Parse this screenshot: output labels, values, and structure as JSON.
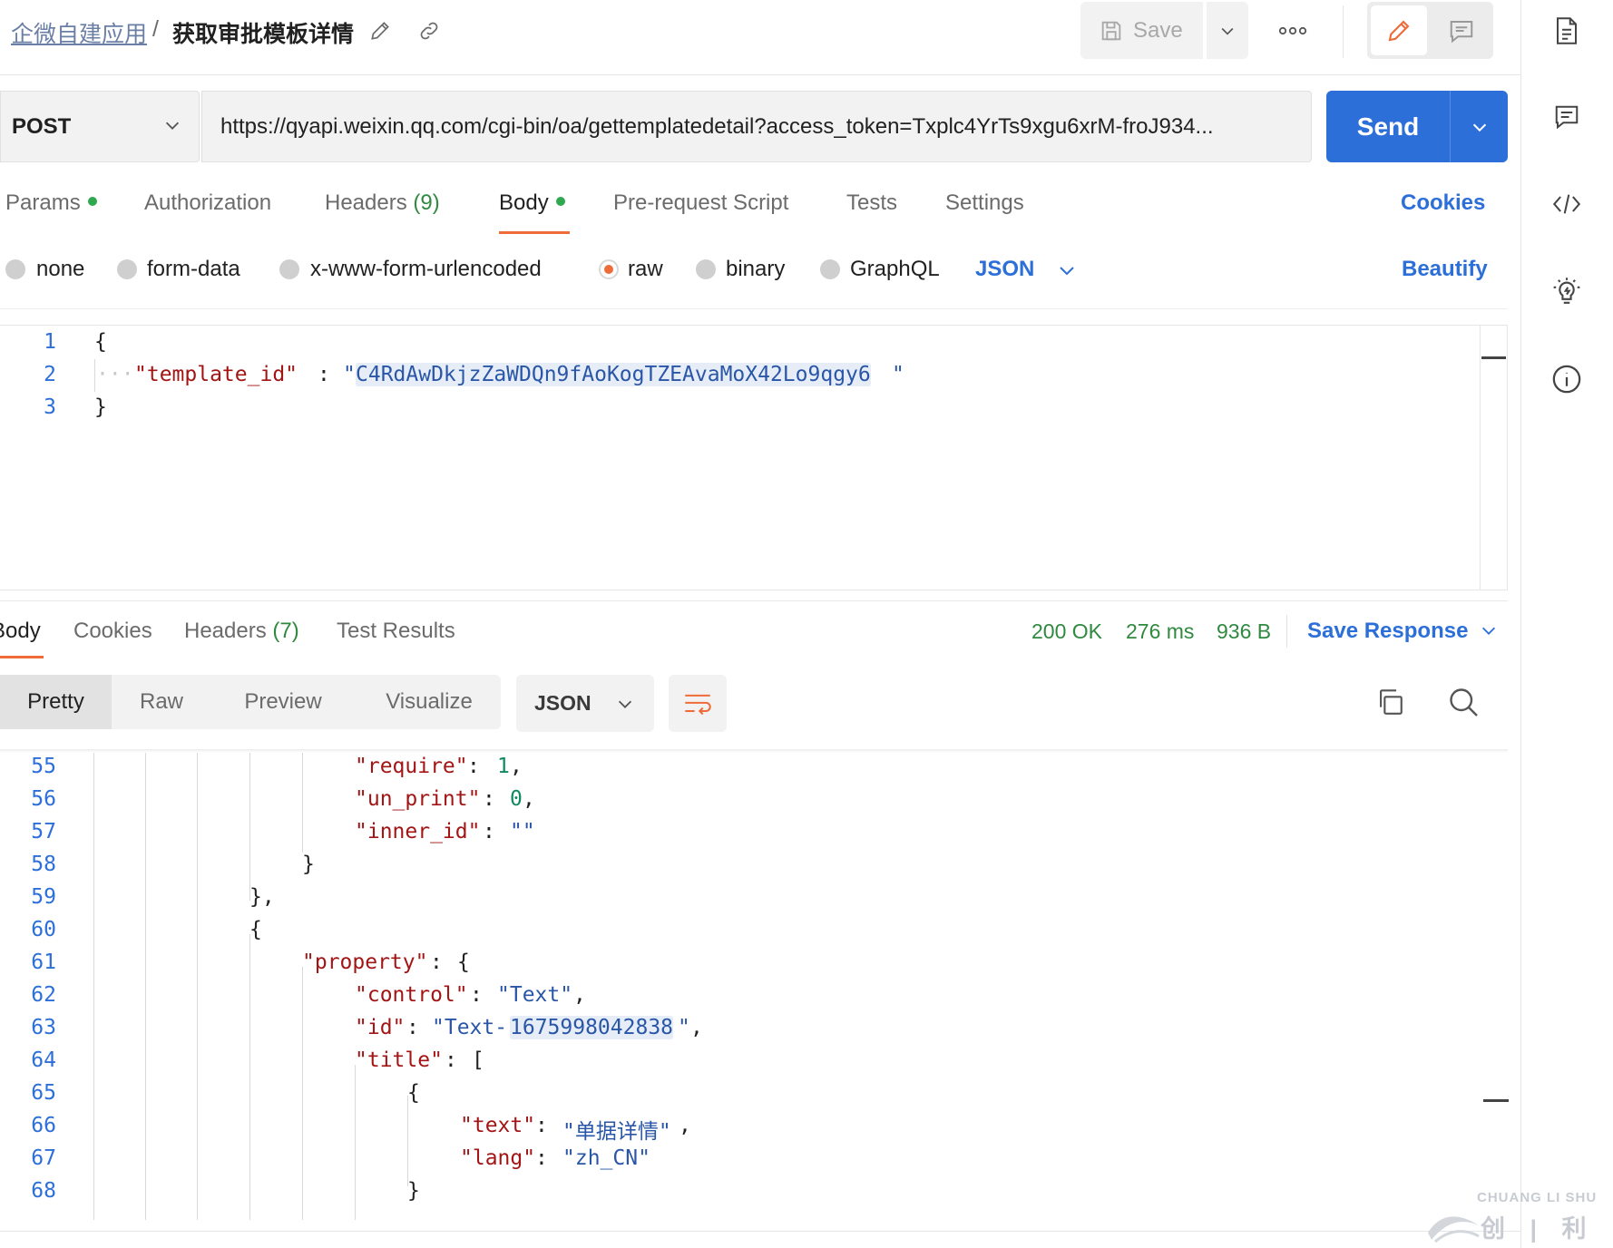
{
  "breadcrumb": {
    "workspace": "企微自建应用",
    "separator": "/",
    "request_name": "获取审批模板详情"
  },
  "toolbar": {
    "save_label": "Save"
  },
  "request": {
    "method": "POST",
    "url": "https://qyapi.weixin.qq.com/cgi-bin/oa/gettemplatedetail?access_token=Txplc4YrTs9xgu6xrM-froJ934...",
    "send_label": "Send"
  },
  "request_tabs": [
    {
      "label": "Params",
      "dot": true
    },
    {
      "label": "Authorization"
    },
    {
      "label": "Headers",
      "count": "(9)"
    },
    {
      "label": "Body",
      "dot": true,
      "active": true
    },
    {
      "label": "Pre-request Script"
    },
    {
      "label": "Tests"
    },
    {
      "label": "Settings"
    }
  ],
  "cookies_label": "Cookies",
  "body_types": {
    "options": [
      "none",
      "form-data",
      "x-www-form-urlencoded",
      "raw",
      "binary",
      "GraphQL"
    ],
    "selected": "raw",
    "format": "JSON",
    "beautify_label": "Beautify"
  },
  "request_body": {
    "line_numbers": [
      "1",
      "2",
      "3"
    ],
    "open_brace": "{",
    "key": "\"template_id\"",
    "colon": ":",
    "value_quote": "\"",
    "value": "C4RdAwDkjzZaWDQn9fAoKogTZEAvaMoX42Lo9qgy6",
    "close_brace": "}"
  },
  "response_tabs": [
    {
      "label": "Body",
      "active": true
    },
    {
      "label": "Cookies"
    },
    {
      "label": "Headers",
      "count": "(7)"
    },
    {
      "label": "Test Results"
    }
  ],
  "response_status": {
    "status": "200 OK",
    "time": "276 ms",
    "size": "936 B",
    "save_label": "Save Response"
  },
  "response_views": {
    "items": [
      "Pretty",
      "Raw",
      "Preview",
      "Visualize"
    ],
    "active": "Pretty",
    "format": "JSON"
  },
  "response_body": {
    "line_numbers": [
      "55",
      "56",
      "57",
      "58",
      "59",
      "60",
      "61",
      "62",
      "63",
      "64",
      "65",
      "66",
      "67",
      "68"
    ],
    "require_key": "\"require\"",
    "require_val": "1",
    "un_print_key": "\"un_print\"",
    "un_print_val": "0",
    "inner_id_key": "\"inner_id\"",
    "inner_id_val": "\"\"",
    "close_brace": "}",
    "close_brace_comma": "},",
    "open_brace": "{",
    "property_key": "\"property\"",
    "control_key": "\"control\"",
    "control_val": "\"Text\"",
    "id_key": "\"id\"",
    "id_val_prefix": "\"Text-",
    "id_val_num": "1675998042838",
    "id_val_suffix": "\"",
    "title_key": "\"title\"",
    "open_bracket": "[",
    "text_key": "\"text\"",
    "text_val": "\"单据详情\"",
    "lang_key": "\"lang\"",
    "lang_val": "\"zh_CN\""
  },
  "watermark": {
    "line1": "CHUANG LI SHU",
    "line2": "创 | 利 | 树"
  },
  "colors": {
    "accent_orange": "#ef6b3a",
    "primary_blue": "#2d6fd9",
    "status_green": "#2f8a3f"
  }
}
